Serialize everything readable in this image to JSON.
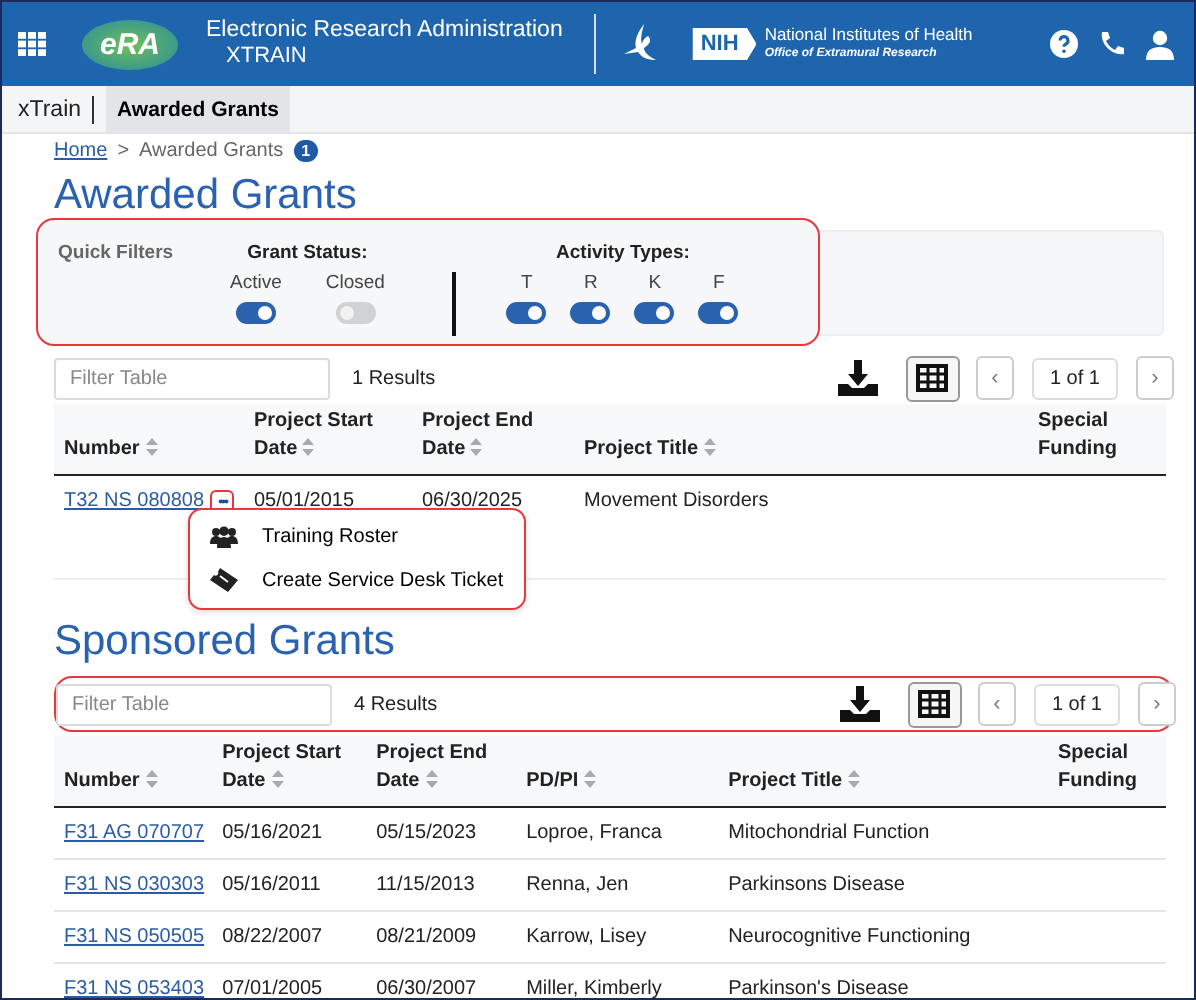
{
  "header": {
    "logo_text": "eRA",
    "title": "Electronic Research Administration",
    "subtitle": "XTRAIN",
    "nih_badge": "NIH",
    "nih_name": "National Institutes of Health",
    "nih_office": "Office of Extramural Research"
  },
  "subnav": {
    "app": "xTrain",
    "tabs": [
      {
        "label": "Awarded Grants",
        "selected": true
      }
    ]
  },
  "breadcrumb": {
    "home": "Home",
    "separator": ">",
    "current": "Awarded Grants",
    "badge": "1"
  },
  "awarded": {
    "title": "Awarded Grants",
    "quick_filters": {
      "label": "Quick Filters",
      "status_title": "Grant Status:",
      "status": [
        {
          "label": "Active",
          "on": true
        },
        {
          "label": "Closed",
          "on": false
        }
      ],
      "activity_title": "Activity Types:",
      "activity": [
        {
          "label": "T",
          "on": true
        },
        {
          "label": "R",
          "on": true
        },
        {
          "label": "K",
          "on": true
        },
        {
          "label": "F",
          "on": true
        }
      ]
    },
    "toolbar": {
      "placeholder": "Filter Table",
      "results": "1 Results",
      "page": "1 of 1",
      "prev": "‹",
      "next": "›"
    },
    "columns": [
      {
        "label": "Number",
        "sortable": true
      },
      {
        "label": "Project Start Date",
        "sortable": true
      },
      {
        "label": "Project End Date",
        "sortable": true
      },
      {
        "label": "Project Title",
        "sortable": true
      },
      {
        "label": "Special Funding",
        "sortable": false
      }
    ],
    "rows": [
      {
        "number": "T32 NS 080808",
        "actions": "•••",
        "start": "05/01/2015",
        "end": "06/30/2025",
        "title": "Movement Disorders"
      }
    ],
    "menu": [
      {
        "label": "Training Roster",
        "kind": "people"
      },
      {
        "label": "Create Service Desk Ticket",
        "kind": "ticket"
      }
    ]
  },
  "sponsored": {
    "title": "Sponsored Grants",
    "toolbar": {
      "placeholder": "Filter Table",
      "results": "4 Results",
      "page": "1 of 1",
      "prev": "‹",
      "next": "›"
    },
    "columns": [
      {
        "label": "Number",
        "sortable": true
      },
      {
        "label": "Project Start Date",
        "sortable": true
      },
      {
        "label": "Project End Date",
        "sortable": true
      },
      {
        "label": "PD/PI",
        "sortable": true
      },
      {
        "label": "Project Title",
        "sortable": true
      },
      {
        "label": "Special Funding",
        "sortable": false
      }
    ],
    "rows": [
      {
        "number": "F31 AG 070707",
        "start": "05/16/2021",
        "end": "05/15/2023",
        "pi": "Loproe, Franca",
        "title": "Mitochondrial Function"
      },
      {
        "number": "F31 NS 030303",
        "start": "05/16/2011",
        "end": "11/15/2013",
        "pi": "Renna, Jen",
        "title": "Parkinsons Disease"
      },
      {
        "number": "F31 NS 050505",
        "start": "08/22/2007",
        "end": "08/21/2009",
        "pi": "Karrow, Lisey",
        "title": "Neurocognitive Functioning"
      },
      {
        "number": "F31 NS 053403",
        "start": "07/01/2005",
        "end": "06/30/2007",
        "pi": "Miller, Kimberly",
        "title": "Parkinson's Disease"
      }
    ]
  }
}
